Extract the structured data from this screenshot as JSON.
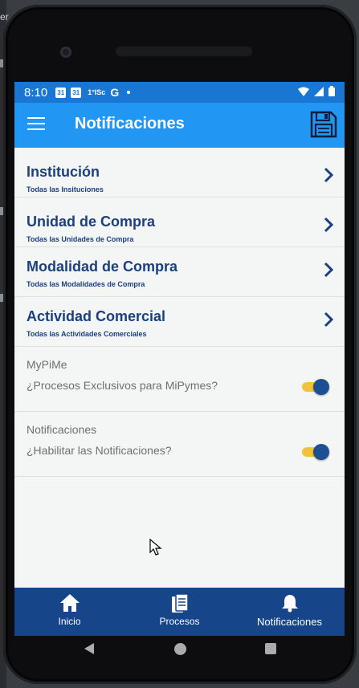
{
  "ide": {
    "text": "er"
  },
  "status": {
    "time": "8:10",
    "calendar_day": "31",
    "mid_text": "1°ISc",
    "g_letter": "G"
  },
  "appbar": {
    "title": "Notificaciones",
    "menu_icon": "hamburger-menu-icon",
    "save_icon": "floppy-disk-icon"
  },
  "nav_items": [
    {
      "title": "Institución",
      "subtitle": "Todas las Insituciones"
    },
    {
      "title": "Unidad de Compra",
      "subtitle": "Todas las Unidades de Compra"
    },
    {
      "title": "Modalidad de Compra",
      "subtitle": "Todas las Modalidades de Compra"
    },
    {
      "title": "Actividad Comercial",
      "subtitle": "Todas las Actividades Comerciales"
    }
  ],
  "toggles": [
    {
      "label": "MyPiMe",
      "question": "¿Procesos Exclusivos para MiPymes?",
      "checked": true
    },
    {
      "label": "Notificaciones",
      "question": "¿Habilitar las Notificaciones?",
      "checked": true
    }
  ],
  "bottom_nav": [
    {
      "label": "Inicio",
      "icon": "home-icon",
      "active": false
    },
    {
      "label": "Procesos",
      "icon": "documents-icon",
      "active": false
    },
    {
      "label": "Notificaciones",
      "icon": "bell-icon",
      "active": true
    }
  ],
  "colors": {
    "appbar": "#2196f3",
    "statusbar": "#1976d2",
    "bottom_nav": "#16458a",
    "title_text": "#1c3f7d",
    "switch_track": "#f2c33a",
    "switch_thumb": "#1d4f93"
  }
}
